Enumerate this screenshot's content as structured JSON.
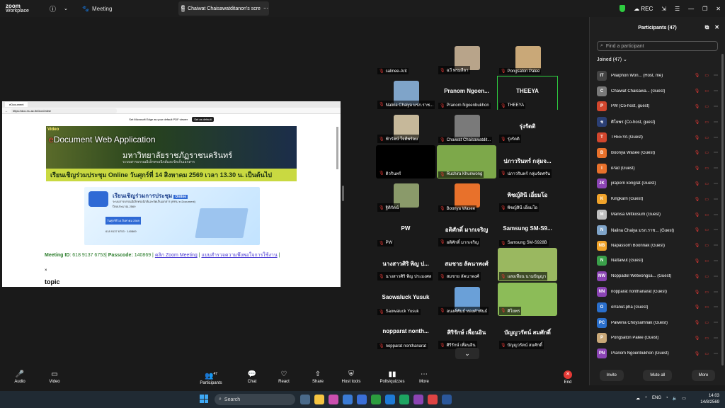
{
  "titlebar": {
    "app_line1": "zoom",
    "app_line2": "Workplace",
    "meeting_label": "Meeting",
    "share_tab": "Chaiwat Chaisawatditanon's scre",
    "rec_label": "REC"
  },
  "share": {
    "browser_tab": "eDocument",
    "url": "https://doc.rru.ac.th/DocOnline",
    "infobar": "Set Microsoft Edge as your default PDF viewer",
    "infobar_btn": "Set as default",
    "banner_video": "Video",
    "banner_e": "e",
    "banner_title": "Document Web Application",
    "banner_uni": "มหาวิทยาลัยราชภัฏราชนครินทร์",
    "banner_sub": "ระบบสารบรรณอิเล็กทรอนิกส์และจัดเก็บเอกสาร",
    "banner_invite": "เรียนเชิญร่วมประชุม Online วันศุกร์ที่ 14 สิงหาคม 2569 เวลา 13.30 น. เป็นต้นไป",
    "invite_title": "เรียนเชิญร่วมการประชุม",
    "invite_online": "Online",
    "invite_desc": "ระบบสารบรรณอิเล็กทรอนิกส์และจัดเก็บเอกสาร (RRU e-Document) ปีงบประมาณ 2569",
    "invite_date": "วันศุกร์ที่ 14 สิงหาคม 2569",
    "invite_meeting_id": "618 9137 6753",
    "invite_passcode": "140869",
    "meeting_id_label": "Meeting ID",
    "meeting_id": ": 618 9137 6753|",
    "passcode_label": "Passcode:",
    "passcode": " 140869 |",
    "link1": "คลิก Zoom Meeting",
    "link2": "แบบสำรวจความพึงพอใจการใช้งาน",
    "x": "×",
    "topic": "topic"
  },
  "gallery": [
    {
      "name": "salinee-Arit",
      "big": "",
      "avatar": "#1a1a1a"
    },
    {
      "name": "ฉวี พรมลีลา",
      "big": "",
      "avatar": "#b8a48a"
    },
    {
      "name": "Pongsaton Palee",
      "big": "",
      "avatar": "#c9a878"
    },
    {
      "name": "Nalina Chaiya มรภ.ราช...",
      "big": "",
      "avatar": "#7fa4c9"
    },
    {
      "name": "Pranom Ngoenbukhon",
      "big": "Pranom Ngoen...",
      "avatar": ""
    },
    {
      "name": "THEEYA",
      "big": "THEEYA",
      "avatar": ""
    },
    {
      "name": "ฟ้ารัตน์ ใจดีพร้อม",
      "big": "",
      "avatar": "#c6b89a"
    },
    {
      "name": "Chaiwat Chaisawatdit...",
      "big": "",
      "avatar": "#7a7a7a"
    },
    {
      "name": "รุ่งรัตติ",
      "big": "รุ่งรัตติ",
      "avatar": ""
    },
    {
      "name": "ดิวรินทร์",
      "big": "",
      "avatar": "#000000"
    },
    {
      "name": "Ruchira Khunwong",
      "big": "",
      "avatar": "#7da84a"
    },
    {
      "name": "ปภาวรินทร์ กลุ่มจัดศรัน",
      "big": "ปภาวรินทร์ กลุ่มจ...",
      "avatar": ""
    },
    {
      "name": "ฐิติรัตน์",
      "big": "",
      "avatar": "#8a9a6a"
    },
    {
      "name": "Boonya Wasee",
      "big": "",
      "avatar": "#e8712b"
    },
    {
      "name": "พิชญ์สินี เอี่ยมโอ",
      "big": "พิชญ์สินี เอี่ยมโอ",
      "avatar": ""
    },
    {
      "name": "PW",
      "big": "PW",
      "avatar": ""
    },
    {
      "name": "อติศักดิ์ มากเจริญ",
      "big": "อติศักดิ์ มากเจริญ",
      "avatar": ""
    },
    {
      "name": "Samsung SM-S928B",
      "big": "Samsung SM-S9...",
      "avatar": ""
    },
    {
      "name": "นางสาวศิริ พิญ ประมงศล",
      "big": "นางสาวศิริ พิญ ป...",
      "avatar": ""
    },
    {
      "name": "สมชาย ลัคนาพงศ์",
      "big": "สมชาย ลัคนาพงศ์",
      "avatar": ""
    },
    {
      "name": "แสงเทียน นามปัญญา",
      "big": "",
      "avatar": "#9ab860"
    },
    {
      "name": "Saowaluck Yusuk",
      "big": "Saowaluck Yusuk",
      "avatar": ""
    },
    {
      "name": "อนงค์พันธ์ ทองคำพันธ์",
      "big": "",
      "avatar": "#6aa0d8"
    },
    {
      "name": "ศิโยพร",
      "big": "",
      "avatar": "#8cbc58"
    },
    {
      "name": "nopparat nonthanarat",
      "big": "nopparat nonth...",
      "avatar": ""
    },
    {
      "name": "ศิริรักษ์ เพื่อนอิน",
      "big": "ศิริรักษ์ เพื่อนอิน",
      "avatar": ""
    },
    {
      "name": "บัญญวรัตน์ สมศักดิ์",
      "big": "บัญญวรัตน์ สมศักดิ์",
      "avatar": ""
    }
  ],
  "gallery_more": "⌄",
  "panel": {
    "title": "Participants (47)",
    "search_placeholder": "Find a participant",
    "joined": "Joined (47)",
    "participants": [
      {
        "initials": "IT",
        "name": "Pilaiphon Won... (Host, me)",
        "color": "#444444"
      },
      {
        "initials": "C",
        "name": "Chaiwat Chaisawa... (Guest)",
        "color": "#7a7a7a"
      },
      {
        "initials": "P",
        "name": "PW (Co-host, guest)",
        "color": "#d2462d"
      },
      {
        "initials": "ช",
        "name": "ศิโยพร (Co-host, guest)",
        "color": "#2b3f74"
      },
      {
        "initials": "T",
        "name": "THEEYA (Guest)",
        "color": "#d2462d"
      },
      {
        "initials": "B",
        "name": "Boonya Wasee (Guest)",
        "color": "#e8712b"
      },
      {
        "initials": "I",
        "name": "iPad (Guest)",
        "color": "#e8712b"
      },
      {
        "initials": "JK",
        "name": "jiraporn kongrat (Guest)",
        "color": "#8b44b4"
      },
      {
        "initials": "K",
        "name": "Kingkarn (Guest)",
        "color": "#f0a32a"
      },
      {
        "initials": "M",
        "name": "Manisa Mittkosum (Guest)",
        "color": "#c0c0c0"
      },
      {
        "initials": "N",
        "name": "Nalina Chaiya มรภ.ราช... (Guest)",
        "color": "#7fa4c9"
      },
      {
        "initials": "NB",
        "name": "Napassorn Boonnak (Guest)",
        "color": "#f0a32a"
      },
      {
        "initials": "N",
        "name": "Nattawut (Guest)",
        "color": "#3aa04a"
      },
      {
        "initials": "NW",
        "name": "Noppadol Wetwongsa... (Guest)",
        "color": "#8b44b4"
      },
      {
        "initials": "NN",
        "name": "nopparat nonthanarat (Guest)",
        "color": "#8b44b4"
      },
      {
        "initials": "O",
        "name": "orranut.pha (Guest)",
        "color": "#2a6fcc"
      },
      {
        "initials": "PC",
        "name": "Pawena Choysamnak (Guest)",
        "color": "#2a6fcc"
      },
      {
        "initials": "P",
        "name": "Pongsaton Palee (Guest)",
        "color": "#c9a878"
      },
      {
        "initials": "PN",
        "name": "Pranom Ngoenbukhon (Guest)",
        "color": "#8b44b4"
      }
    ],
    "footer": {
      "invite": "Invite",
      "mute_all": "Mute all",
      "more": "More"
    }
  },
  "toolbar": {
    "audio": "Audio",
    "video": "Video",
    "participants": "Participants",
    "participant_count": "47",
    "chat": "Chat",
    "react": "React",
    "share": "Share",
    "host_tools": "Host tools",
    "polls": "Polls/quizzes",
    "more": "More",
    "end": "End"
  },
  "taskbar": {
    "search": "Search",
    "lang": "ENG",
    "time": "14:03",
    "date": "14/8/2569"
  }
}
